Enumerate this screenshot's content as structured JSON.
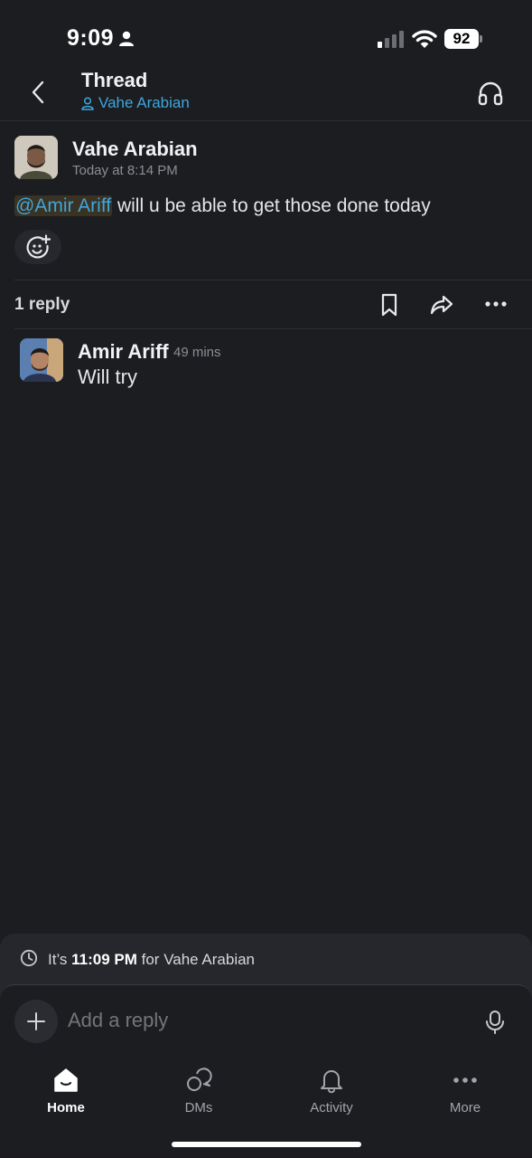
{
  "status_bar": {
    "time": "9:09",
    "battery": "92"
  },
  "header": {
    "title": "Thread",
    "channel": "Vahe Arabian"
  },
  "parent_message": {
    "sender": "Vahe Arabian",
    "timestamp": "Today at 8:14 PM",
    "mention": "@Amir Ariff",
    "text": " will u be able to get those done today"
  },
  "thread": {
    "reply_count": "1 reply"
  },
  "reply": {
    "sender": "Amir Ariff",
    "time": "49 mins",
    "text": "Will try"
  },
  "local_time": {
    "prefix": "It’s ",
    "time": "11:09 PM",
    "suffix": " for Vahe Arabian"
  },
  "composer": {
    "placeholder": "Add a reply"
  },
  "tabs": [
    {
      "label": "Home",
      "icon": "home-icon"
    },
    {
      "label": "DMs",
      "icon": "dms-icon"
    },
    {
      "label": "Activity",
      "icon": "bell-icon"
    },
    {
      "label": "More",
      "icon": "more-icon"
    }
  ],
  "colors": {
    "background": "#1b1d21",
    "link": "#3ea6dd",
    "mention_bg": "#3a3222"
  }
}
